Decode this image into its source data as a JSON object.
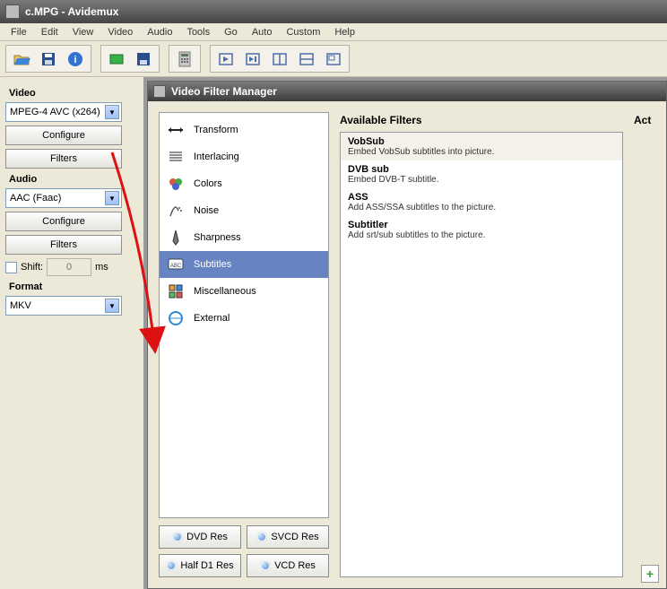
{
  "window": {
    "title": "c.MPG - Avidemux"
  },
  "menu": [
    "File",
    "Edit",
    "View",
    "Video",
    "Audio",
    "Tools",
    "Go",
    "Auto",
    "Custom",
    "Help"
  ],
  "sidebar": {
    "video": {
      "label": "Video",
      "codec": "MPEG-4 AVC (x264)",
      "configure": "Configure",
      "filters": "Filters"
    },
    "audio": {
      "label": "Audio",
      "codec": "AAC (Faac)",
      "configure": "Configure",
      "filters": "Filters",
      "shift_label": "Shift:",
      "shift_value": "0",
      "shift_unit": "ms"
    },
    "format": {
      "label": "Format",
      "value": "MKV"
    }
  },
  "dialog": {
    "title": "Video Filter Manager",
    "categories": [
      {
        "name": "Transform",
        "icon": "transform"
      },
      {
        "name": "Interlacing",
        "icon": "interlace"
      },
      {
        "name": "Colors",
        "icon": "colors"
      },
      {
        "name": "Noise",
        "icon": "noise"
      },
      {
        "name": "Sharpness",
        "icon": "sharp"
      },
      {
        "name": "Subtitles",
        "icon": "subtitles",
        "selected": true
      },
      {
        "name": "Miscellaneous",
        "icon": "misc"
      },
      {
        "name": "External",
        "icon": "external"
      }
    ],
    "res_buttons": [
      "DVD Res",
      "SVCD Res",
      "Half D1 Res",
      "VCD Res"
    ],
    "available_label": "Available Filters",
    "active_label": "Act",
    "filters": [
      {
        "name": "VobSub",
        "desc": "Embed VobSub subtitles into picture."
      },
      {
        "name": "DVB sub",
        "desc": "Embed DVB-T subtitle."
      },
      {
        "name": "ASS",
        "desc": "Add ASS/SSA subtitles to the picture."
      },
      {
        "name": "Subtitler",
        "desc": "Add srt/sub subtitles to the picture."
      }
    ]
  }
}
